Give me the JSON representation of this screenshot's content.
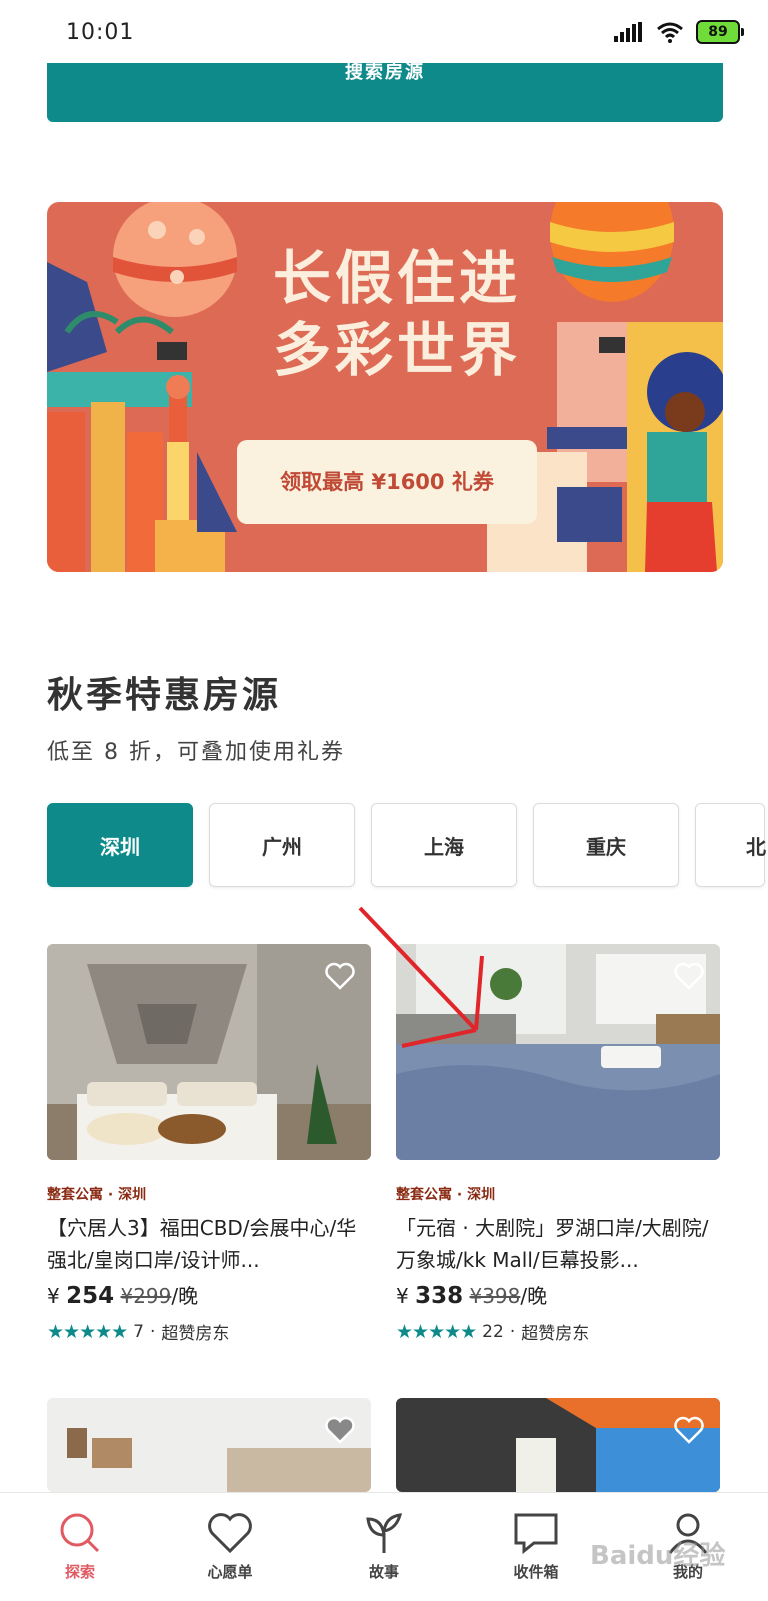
{
  "status_bar": {
    "time": "10:01",
    "battery": "89"
  },
  "search_button": {
    "label": "搜索房源"
  },
  "banner": {
    "title_line1": "长假住进",
    "title_line2": "多彩世界",
    "coupon_label": "领取最高 ¥1600 礼券"
  },
  "section": {
    "title": "秋季特惠房源",
    "subtitle": "低至 8 折，可叠加使用礼券"
  },
  "city_tabs": [
    {
      "label": "深圳",
      "active": true
    },
    {
      "label": "广州",
      "active": false
    },
    {
      "label": "上海",
      "active": false
    },
    {
      "label": "重庆",
      "active": false
    },
    {
      "label": "北",
      "active": false
    }
  ],
  "listings": [
    {
      "type": "整套公寓 · 深圳",
      "title": "【穴居人3】福田CBD/会展中心/华强北/皇岗口岸/设计师...",
      "price_now": "254",
      "price_old": "¥299",
      "per_night": "/晚",
      "currency": "¥",
      "rating_count": "7",
      "host_badge": "超赞房东"
    },
    {
      "type": "整套公寓 · 深圳",
      "title": "「元宿 · 大剧院」罗湖口岸/大剧院/万象城/kk Mall/巨幕投影...",
      "price_now": "338",
      "price_old": "¥398",
      "per_night": "/晚",
      "currency": "¥",
      "rating_count": "22",
      "host_badge": "超赞房东"
    }
  ],
  "bottom_nav": [
    {
      "label": "探索",
      "icon": "search-icon",
      "active": true
    },
    {
      "label": "心愿单",
      "icon": "heart-icon",
      "active": false
    },
    {
      "label": "故事",
      "icon": "sprout-icon",
      "active": false
    },
    {
      "label": "收件箱",
      "icon": "message-icon",
      "active": false
    },
    {
      "label": "我的",
      "icon": "profile-icon",
      "active": false
    }
  ],
  "watermark": "Baidu经验",
  "colors": {
    "accent": "#0f8a8a",
    "active_nav": "#e05a62",
    "banner": "#dd6a55"
  }
}
